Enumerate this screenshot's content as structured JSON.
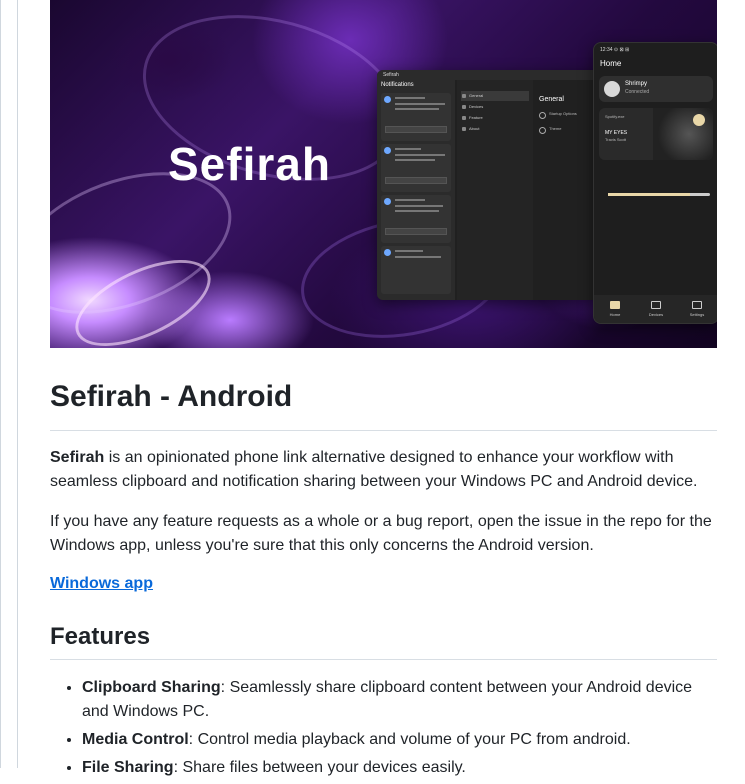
{
  "banner": {
    "brand": "Sefirah",
    "desktop": {
      "app_title": "Sefirah",
      "notifications_header": "Notifications",
      "settings_items": [
        "General",
        "Devices",
        "Feature",
        "About"
      ],
      "general_header": "General",
      "general_rows": [
        "Startup Options",
        "Theme"
      ]
    },
    "phone": {
      "status": "12:34 ⊙ ⊠ ⊞",
      "home_title": "Home",
      "device_name": "Shrimpy",
      "device_status": "Connected",
      "media_source": "Spotify.exe",
      "media_title": "MY EYES",
      "media_artist": "Travis Scott",
      "nav": [
        "Home",
        "Devices",
        "Settings"
      ]
    }
  },
  "article": {
    "title": "Sefirah - Android",
    "intro_bold": "Sefirah",
    "intro_rest": " is an opinionated phone link alternative designed to enhance your workflow with seamless clipboard and notification sharing between your Windows PC and Android device.",
    "para2": "If you have any feature requests as a whole or a bug report, open the issue in the repo for the Windows app, unless you're sure that this only concerns the Android version.",
    "link": "Windows app",
    "features_heading": "Features",
    "features": [
      {
        "name": "Clipboard Sharing",
        "desc": ": Seamlessly share clipboard content between your Android device and Windows PC."
      },
      {
        "name": "Media Control",
        "desc": ": Control media playback and volume of your PC from android."
      },
      {
        "name": "File Sharing",
        "desc": ": Share files between your devices easily."
      }
    ]
  }
}
